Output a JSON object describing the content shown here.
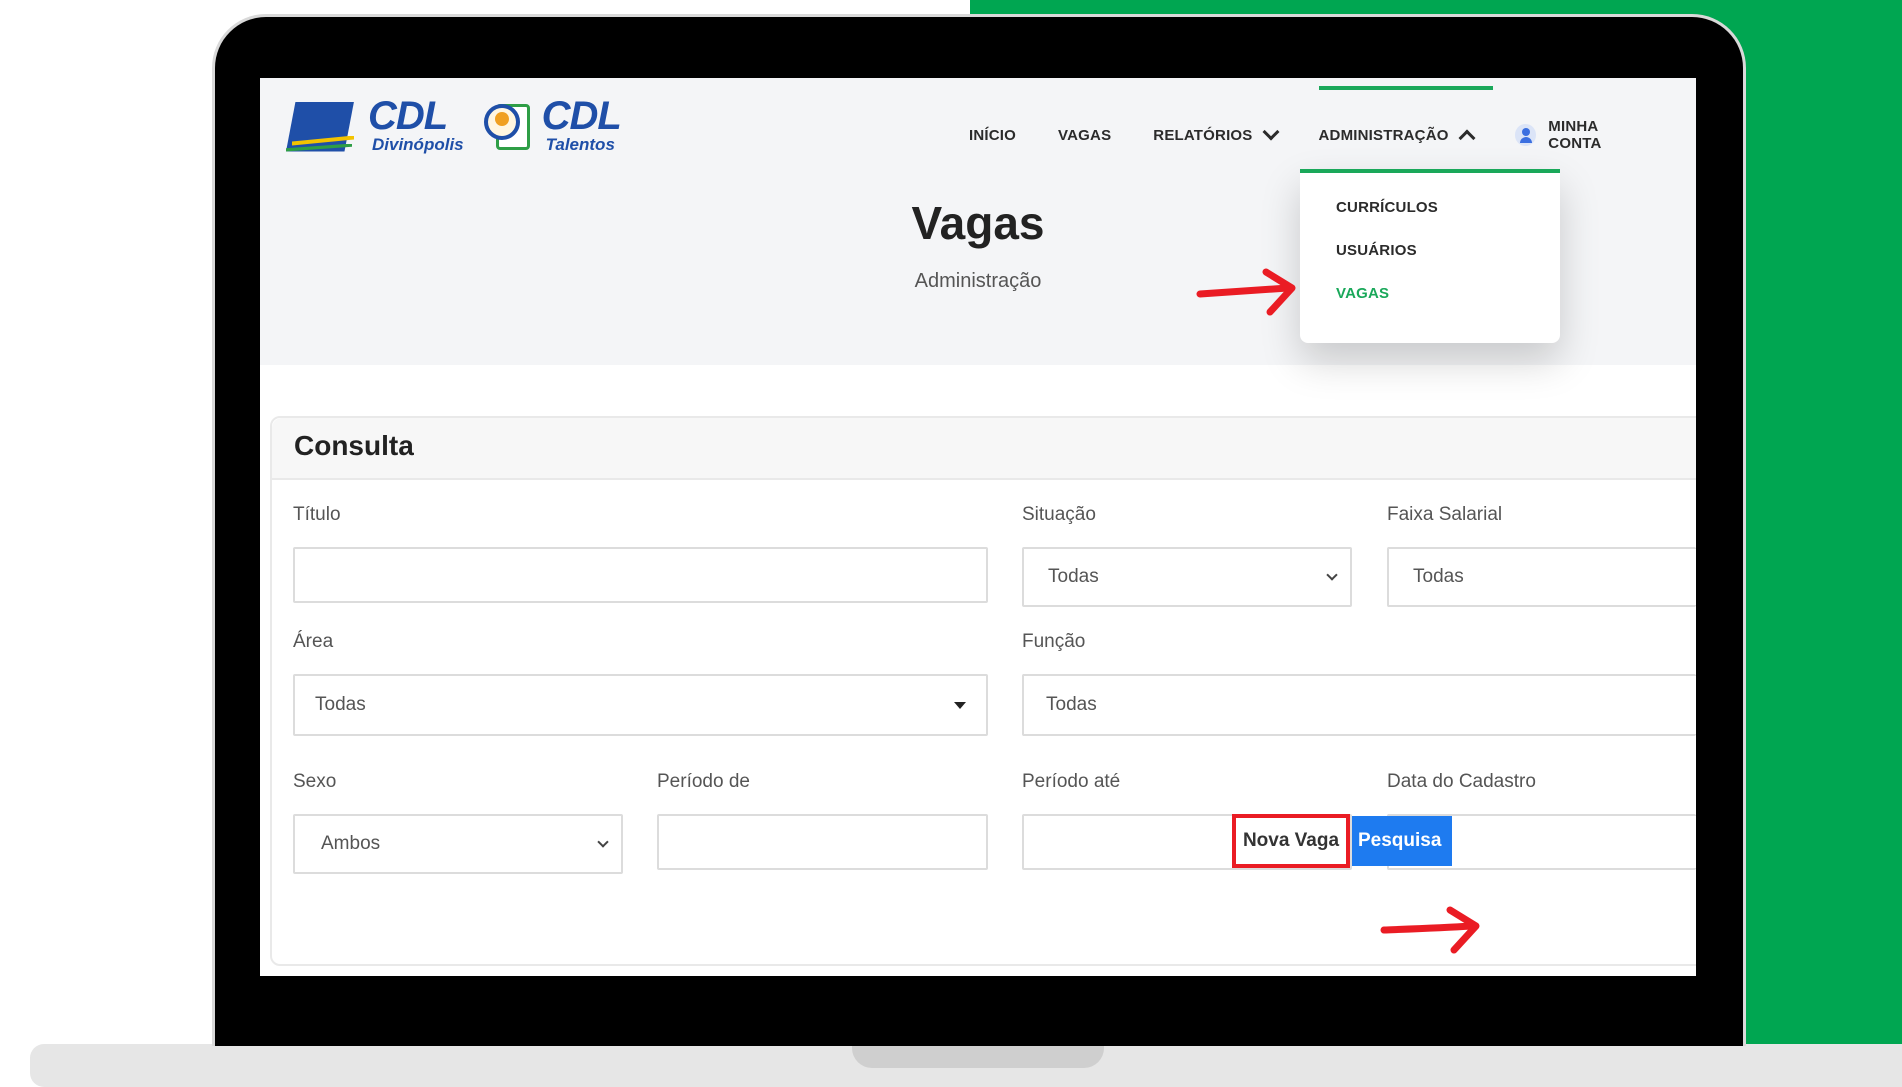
{
  "brand": {
    "logo1_big": "CDL",
    "logo1_small": "Divinópolis",
    "logo2_big": "CDL",
    "logo2_small": "Talentos"
  },
  "nav": {
    "inicio": "INÍCIO",
    "vagas": "VAGAS",
    "relatorios": "RELATÓRIOS",
    "administracao": "ADMINISTRAÇÃO",
    "minha_conta": "MINHA CONTA"
  },
  "dropdown": {
    "items": [
      "CURRÍCULOS",
      "USUÁRIOS",
      "VAGAS"
    ],
    "active": "VAGAS"
  },
  "page": {
    "title": "Vagas",
    "subtitle": "Administração"
  },
  "card": {
    "title": "Consulta"
  },
  "form": {
    "titulo_label": "Título",
    "situacao_label": "Situação",
    "situacao_value": "Todas",
    "faixa_label": "Faixa Salarial",
    "faixa_value": "Todas",
    "area_label": "Área",
    "area_value": "Todas",
    "funcao_label": "Função",
    "funcao_value": "Todas",
    "sexo_label": "Sexo",
    "sexo_value": "Ambos",
    "periodo_de_label": "Período de",
    "periodo_ate_label": "Período até",
    "data_cadastro_label": "Data do Cadastro"
  },
  "buttons": {
    "nova_vaga": "Nova Vaga",
    "pesquisar": "Pesquisa"
  },
  "colors": {
    "brand_green": "#00a651",
    "accent_green": "#1aa85a",
    "primary_blue": "#1e7bf0",
    "highlight_red": "#ea1c24"
  }
}
